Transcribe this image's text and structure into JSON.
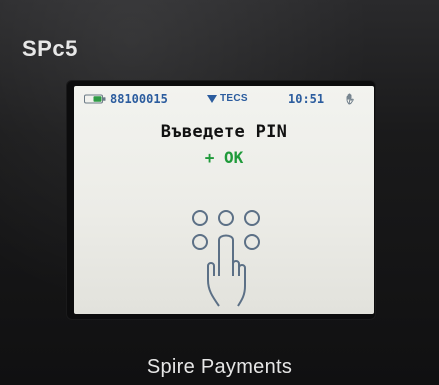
{
  "device": {
    "model_label": "SPc5",
    "brand_label": "Spire Payments"
  },
  "screen": {
    "status_bar": {
      "terminal_id": "88100015",
      "network": "TECS",
      "time": "10:51"
    },
    "prompt": "Въведете PIN",
    "ok_hint": "+ OK"
  },
  "icons": {
    "battery": "battery-icon",
    "network": "network-signal-icon",
    "contactless": "hand-icon",
    "keypad": "pin-keypad-finger-icon"
  },
  "colors": {
    "status_text": "#2b5c9e",
    "ok_text": "#1f9a3a",
    "prompt_text": "#111111",
    "screen_bg": "#f2f3ef",
    "device_body": "#1a1a1b"
  }
}
